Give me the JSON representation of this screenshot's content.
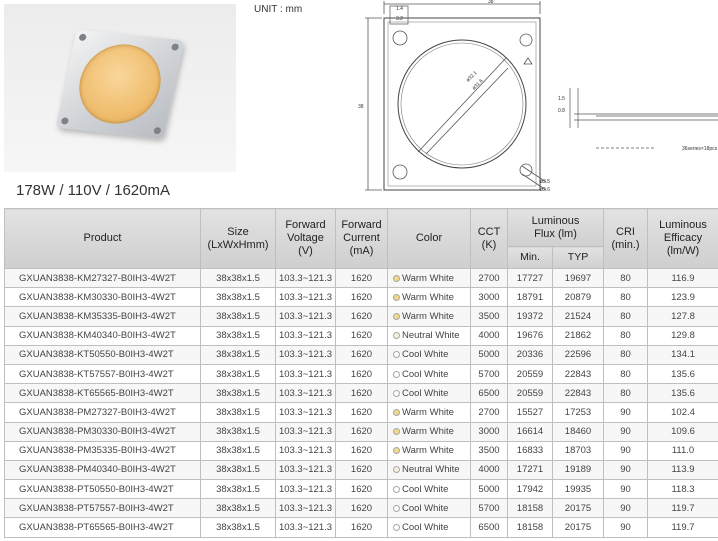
{
  "caption": "178W / 110V / 1620mA",
  "unit_label": "UNIT : mm",
  "drawing": {
    "top_dim": "38",
    "side_dim": "38",
    "small_dim_a": "1.4",
    "small_dim_b": "3.2",
    "diameter_a": "ø32.1",
    "diameter_b": "ø31.6",
    "hole_a": "ø3.5",
    "hole_b": "ø2.6",
    "height_dim": "1.5",
    "thickness_dim": "0.8",
    "side_note": "36series×18pcs"
  },
  "table": {
    "headers": {
      "product": "Product",
      "size": [
        "Size",
        "(LxWxHmm)"
      ],
      "forward_voltage": [
        "Forward",
        "Voltage",
        "(V)"
      ],
      "forward_current": [
        "Forward",
        "Current",
        "(mA)"
      ],
      "color": "Color",
      "cct": [
        "CCT",
        "(K)"
      ],
      "luminous_flux": [
        "Luminous",
        "Flux (lm)"
      ],
      "flux_min": "Min.",
      "flux_typ": "TYP",
      "cri": [
        "CRI",
        "(min.)"
      ],
      "efficacy": [
        "Luminous",
        "Efficacy",
        "(lm/W)"
      ]
    },
    "rows": [
      {
        "product": "GXUAN3838-KM27327-B0IH3-4W2T",
        "size": "38x38x1.5",
        "voltage": "103.3~121.3",
        "current": "1620",
        "color": "Warm White",
        "color_dot": "#f2d98a",
        "cct": "2700",
        "flux_min": "17727",
        "flux_typ": "19697",
        "cri": "80",
        "efficacy": "116.9"
      },
      {
        "product": "GXUAN3838-KM30330-B0IH3-4W2T",
        "size": "38x38x1.5",
        "voltage": "103.3~121.3",
        "current": "1620",
        "color": "Warm White",
        "color_dot": "#f2d98a",
        "cct": "3000",
        "flux_min": "18791",
        "flux_typ": "20879",
        "cri": "80",
        "efficacy": "123.9"
      },
      {
        "product": "GXUAN3838-KM35335-B0IH3-4W2T",
        "size": "38x38x1.5",
        "voltage": "103.3~121.3",
        "current": "1620",
        "color": "Warm White",
        "color_dot": "#f2d98a",
        "cct": "3500",
        "flux_min": "19372",
        "flux_typ": "21524",
        "cri": "80",
        "efficacy": "127.8"
      },
      {
        "product": "GXUAN3838-KM40340-B0IH3-4W2T",
        "size": "38x38x1.5",
        "voltage": "103.3~121.3",
        "current": "1620",
        "color": "Neutral White",
        "color_dot": "#f7f1dc",
        "cct": "4000",
        "flux_min": "19676",
        "flux_typ": "21862",
        "cri": "80",
        "efficacy": "129.8"
      },
      {
        "product": "GXUAN3838-KT50550-B0IH3-4W2T",
        "size": "38x38x1.5",
        "voltage": "103.3~121.3",
        "current": "1620",
        "color": "Cool White",
        "color_dot": "#ffffff",
        "cct": "5000",
        "flux_min": "20336",
        "flux_typ": "22596",
        "cri": "80",
        "efficacy": "134.1"
      },
      {
        "product": "GXUAN3838-KT57557-B0IH3-4W2T",
        "size": "38x38x1.5",
        "voltage": "103.3~121.3",
        "current": "1620",
        "color": "Cool White",
        "color_dot": "#ffffff",
        "cct": "5700",
        "flux_min": "20559",
        "flux_typ": "22843",
        "cri": "80",
        "efficacy": "135.6"
      },
      {
        "product": "GXUAN3838-KT65565-B0IH3-4W2T",
        "size": "38x38x1.5",
        "voltage": "103.3~121.3",
        "current": "1620",
        "color": "Cool White",
        "color_dot": "#ffffff",
        "cct": "6500",
        "flux_min": "20559",
        "flux_typ": "22843",
        "cri": "80",
        "efficacy": "135.6"
      },
      {
        "product": "GXUAN3838-PM27327-B0IH3-4W2T",
        "size": "38x38x1.5",
        "voltage": "103.3~121.3",
        "current": "1620",
        "color": "Warm White",
        "color_dot": "#f2d98a",
        "cct": "2700",
        "flux_min": "15527",
        "flux_typ": "17253",
        "cri": "90",
        "efficacy": "102.4"
      },
      {
        "product": "GXUAN3838-PM30330-B0IH3-4W2T",
        "size": "38x38x1.5",
        "voltage": "103.3~121.3",
        "current": "1620",
        "color": "Warm White",
        "color_dot": "#f2d98a",
        "cct": "3000",
        "flux_min": "16614",
        "flux_typ": "18460",
        "cri": "90",
        "efficacy": "109.6"
      },
      {
        "product": "GXUAN3838-PM35335-B0IH3-4W2T",
        "size": "38x38x1.5",
        "voltage": "103.3~121.3",
        "current": "1620",
        "color": "Warm White",
        "color_dot": "#f2d98a",
        "cct": "3500",
        "flux_min": "16833",
        "flux_typ": "18703",
        "cri": "90",
        "efficacy": "111.0"
      },
      {
        "product": "GXUAN3838-PM40340-B0IH3-4W2T",
        "size": "38x38x1.5",
        "voltage": "103.3~121.3",
        "current": "1620",
        "color": "Neutral White",
        "color_dot": "#f7f1dc",
        "cct": "4000",
        "flux_min": "17271",
        "flux_typ": "19189",
        "cri": "90",
        "efficacy": "113.9"
      },
      {
        "product": "GXUAN3838-PT50550-B0IH3-4W2T",
        "size": "38x38x1.5",
        "voltage": "103.3~121.3",
        "current": "1620",
        "color": "Cool White",
        "color_dot": "#ffffff",
        "cct": "5000",
        "flux_min": "17942",
        "flux_typ": "19935",
        "cri": "90",
        "efficacy": "118.3"
      },
      {
        "product": "GXUAN3838-PT57557-B0IH3-4W2T",
        "size": "38x38x1.5",
        "voltage": "103.3~121.3",
        "current": "1620",
        "color": "Cool White",
        "color_dot": "#ffffff",
        "cct": "5700",
        "flux_min": "18158",
        "flux_typ": "20175",
        "cri": "90",
        "efficacy": "119.7"
      },
      {
        "product": "GXUAN3838-PT65565-B0IH3-4W2T",
        "size": "38x38x1.5",
        "voltage": "103.3~121.3",
        "current": "1620",
        "color": "Cool White",
        "color_dot": "#ffffff",
        "cct": "6500",
        "flux_min": "18158",
        "flux_typ": "20175",
        "cri": "90",
        "efficacy": "119.7"
      }
    ]
  }
}
